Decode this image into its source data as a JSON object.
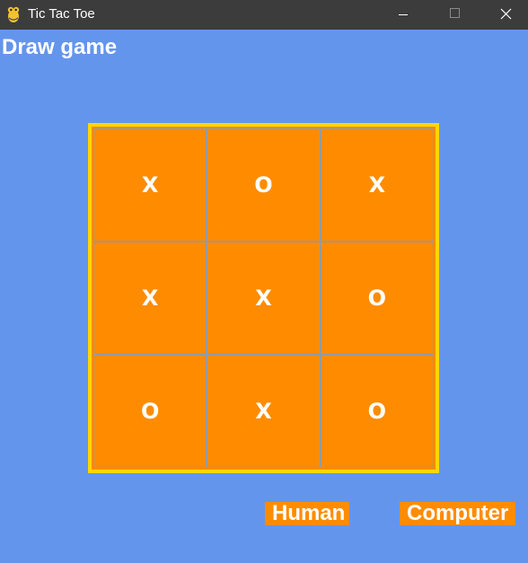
{
  "window": {
    "title": "Tic Tac Toe",
    "app_icon": "pygame-snake-icon"
  },
  "status": {
    "text": "Draw game"
  },
  "board": {
    "cells": [
      "X",
      "O",
      "X",
      "X",
      "X",
      "O",
      "O",
      "X",
      "O"
    ]
  },
  "players": {
    "human_label": "Human",
    "computer_label": "Computer"
  },
  "colors": {
    "background": "#6495ED",
    "board_fill": "#FF8C00",
    "board_border": "#FFD700",
    "mark": "#FFFFFF"
  }
}
